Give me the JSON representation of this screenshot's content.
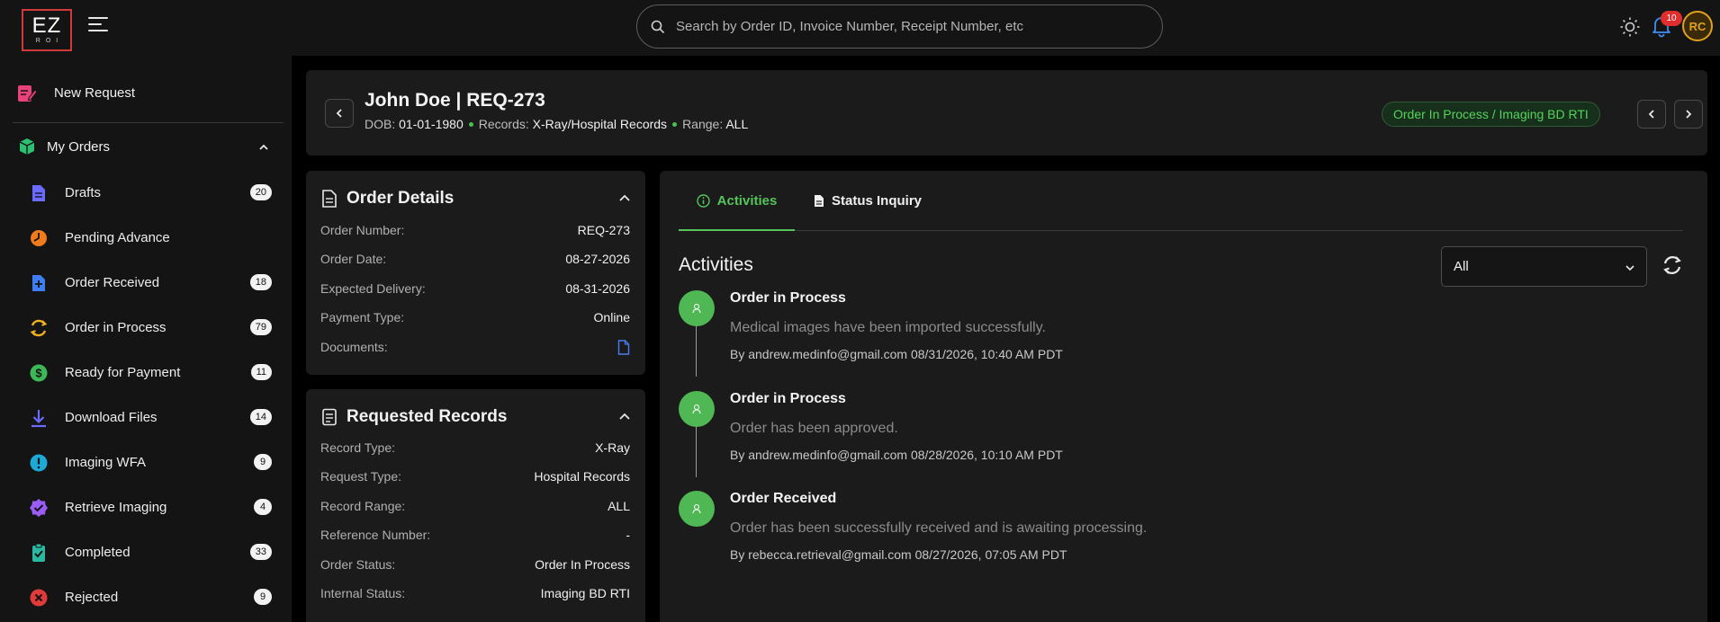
{
  "brand": {
    "logo_text": "EZ",
    "logo_sub": "ROI"
  },
  "search": {
    "placeholder": "Search by Order ID, Invoice Number, Receipt Number, etc"
  },
  "notifications": {
    "count": "10"
  },
  "user": {
    "initials": "RC"
  },
  "sidebar": {
    "new_request": "New Request",
    "my_orders": "My Orders",
    "items": [
      {
        "label": "Drafts",
        "count": "20",
        "icon": "document-icon",
        "color": "#6b6bff"
      },
      {
        "label": "Pending Advance",
        "count": "",
        "icon": "clock-icon",
        "color": "#f07b1d"
      },
      {
        "label": "Order Received",
        "count": "18",
        "icon": "file-plus-icon",
        "color": "#3f7df2"
      },
      {
        "label": "Order in Process",
        "count": "79",
        "icon": "sync-icon",
        "color": "#f2b31d"
      },
      {
        "label": "Ready for Payment",
        "count": "11",
        "icon": "dollar-icon",
        "color": "#3db856"
      },
      {
        "label": "Download Files",
        "count": "14",
        "icon": "download-icon",
        "color": "#6b6bff"
      },
      {
        "label": "Imaging WFA",
        "count": "9",
        "icon": "alert-icon",
        "color": "#1fa9d6"
      },
      {
        "label": "Retrieve Imaging",
        "count": "4",
        "icon": "check-badge-icon",
        "color": "#9a5cf5"
      },
      {
        "label": "Completed",
        "count": "33",
        "icon": "clipboard-check-icon",
        "color": "#2bb8a0"
      },
      {
        "label": "Rejected",
        "count": "9",
        "icon": "x-circle-icon",
        "color": "#e03a3a"
      }
    ]
  },
  "header": {
    "title": "John Doe | REQ-273",
    "dob_label": "DOB:",
    "dob": "01-01-1980",
    "records_label": "Records:",
    "records": "X-Ray/Hospital Records",
    "range_label": "Range:",
    "range": "ALL",
    "status": "Order In Process / Imaging BD RTI"
  },
  "order_details": {
    "title": "Order Details",
    "rows": [
      {
        "k": "Order Number:",
        "v": "REQ-273"
      },
      {
        "k": "Order Date:",
        "v": "08-27-2026"
      },
      {
        "k": "Expected Delivery:",
        "v": "08-31-2026"
      },
      {
        "k": "Payment Type:",
        "v": "Online"
      },
      {
        "k": "Documents:",
        "v": ""
      }
    ]
  },
  "requested_records": {
    "title": "Requested Records",
    "rows": [
      {
        "k": "Record Type:",
        "v": "X-Ray"
      },
      {
        "k": "Request Type:",
        "v": "Hospital Records"
      },
      {
        "k": "Record Range:",
        "v": "ALL"
      },
      {
        "k": "Reference Number:",
        "v": "-"
      },
      {
        "k": "Order Status:",
        "v": "Order In Process"
      },
      {
        "k": "Internal Status:",
        "v": "Imaging BD RTI"
      }
    ]
  },
  "activity": {
    "tabs": [
      "Activities",
      "Status Inquiry"
    ],
    "heading": "Activities",
    "filter_value": "All",
    "items": [
      {
        "title": "Order in Process",
        "desc": "Medical images have been imported successfully.",
        "by": "By andrew.medinfo@gmail.com 08/31/2026, 10:40 AM PDT"
      },
      {
        "title": "Order in Process",
        "desc": "Order has been approved.",
        "by": "By andrew.medinfo@gmail.com 08/28/2026, 10:10 AM PDT"
      },
      {
        "title": "Order Received",
        "desc": "Order has been successfully received and is awaiting processing.",
        "by": "By rebecca.retrieval@gmail.com 08/27/2026, 07:05 AM PDT"
      }
    ]
  },
  "colors": {
    "accent_green": "#55c45a",
    "brand_red": "#d03a3a",
    "badge_red": "#e02d2d"
  }
}
